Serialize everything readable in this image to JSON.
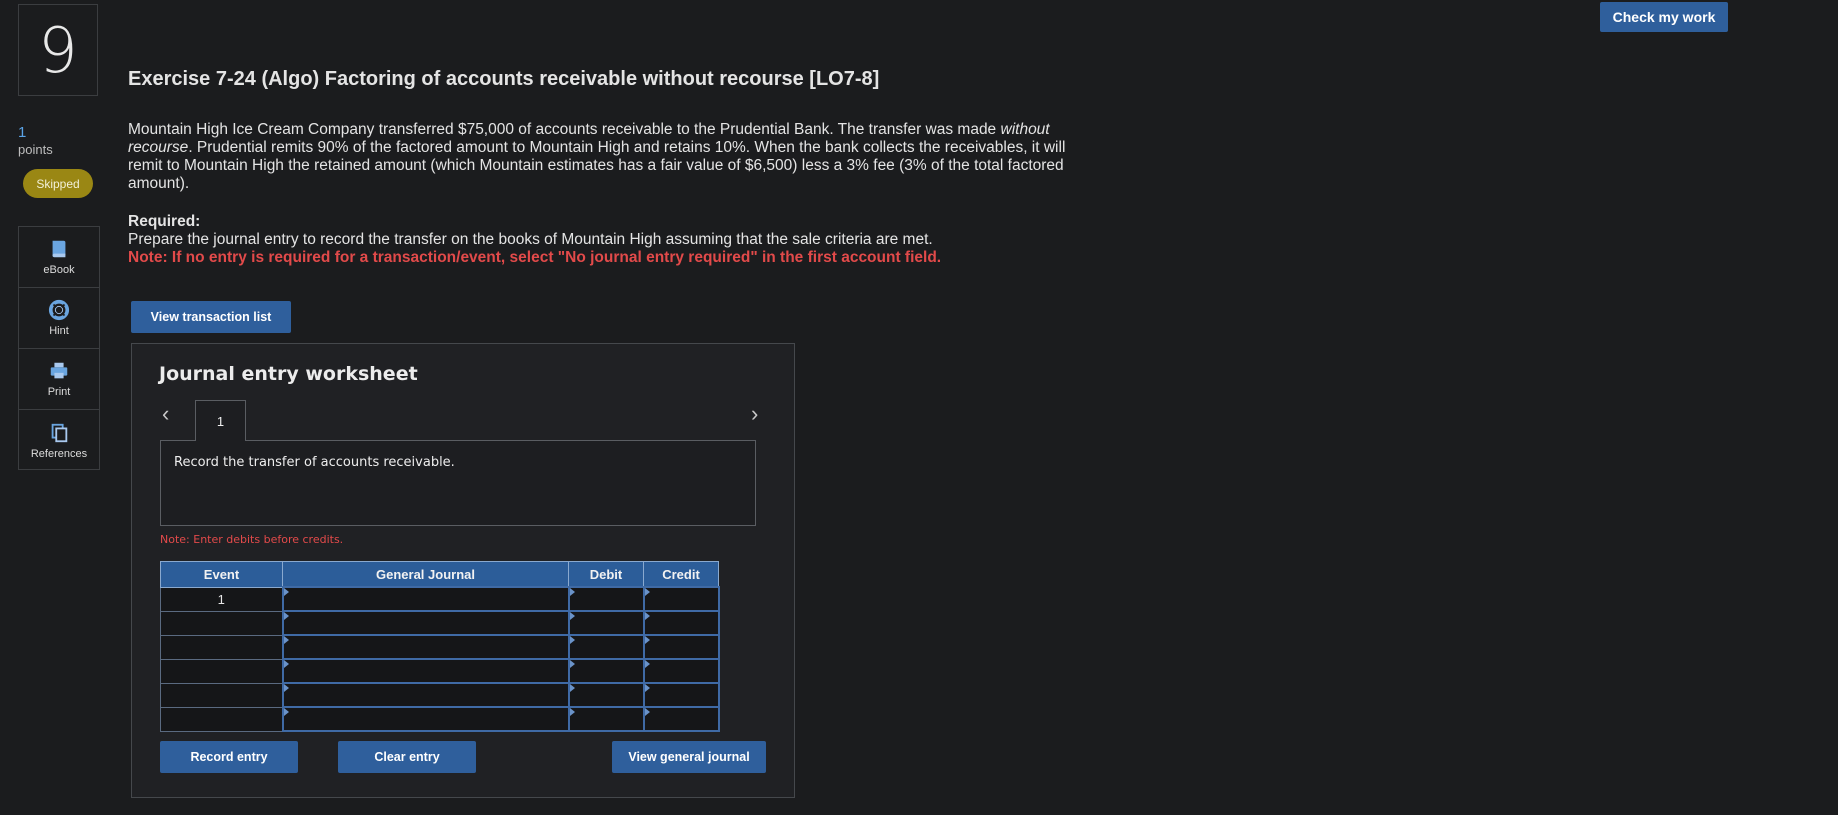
{
  "question": {
    "number": "9",
    "points_value": "1",
    "points_label": "points",
    "status": "Skipped"
  },
  "tools": [
    {
      "label": "eBook",
      "icon": "book-icon"
    },
    {
      "label": "Hint",
      "icon": "lifebuoy-icon"
    },
    {
      "label": "Print",
      "icon": "printer-icon"
    },
    {
      "label": "References",
      "icon": "copy-icon"
    }
  ],
  "header": {
    "check_label": "Check my work"
  },
  "exercise": {
    "title": "Exercise 7-24 (Algo) Factoring of accounts receivable without recourse [LO7-8]",
    "para_part1": "Mountain High Ice Cream Company transferred $75,000 of accounts receivable to the Prudential Bank. The transfer was made ",
    "para_italic": "without recourse",
    "para_part2": ". Prudential remits 90% of the factored amount to Mountain High and retains 10%. When the bank collects the receivables, it will remit to Mountain High the retained amount (which Mountain estimates has a fair value of $6,500) less a 3% fee (3% of the total factored amount).",
    "required_heading": "Required:",
    "required_text": "Prepare the journal entry to record the transfer on the books of Mountain High assuming that the sale criteria are met.",
    "required_note": "Note: If no entry is required for a transaction/event, select \"No journal entry required\" in the first account field."
  },
  "view_transaction_label": "View transaction list",
  "worksheet": {
    "title": "Journal entry worksheet",
    "tab_label": "1",
    "description": "Record the transfer of accounts receivable.",
    "debits_note": "Note: Enter debits before credits.",
    "columns": [
      "Event",
      "General Journal",
      "Debit",
      "Credit"
    ],
    "rows": [
      {
        "event": "1",
        "account": "",
        "debit": "",
        "credit": ""
      },
      {
        "event": "",
        "account": "",
        "debit": "",
        "credit": ""
      },
      {
        "event": "",
        "account": "",
        "debit": "",
        "credit": ""
      },
      {
        "event": "",
        "account": "",
        "debit": "",
        "credit": ""
      },
      {
        "event": "",
        "account": "",
        "debit": "",
        "credit": ""
      },
      {
        "event": "",
        "account": "",
        "debit": "",
        "credit": ""
      }
    ],
    "record_label": "Record entry",
    "clear_label": "Clear entry",
    "view_journal_label": "View general journal"
  },
  "colors": {
    "background": "#1b1c1e",
    "accent_blue": "#2f5f9c",
    "note_red": "#e24a4a",
    "skipped_badge": "#9a8714",
    "points_blue": "#5aa3e6"
  }
}
